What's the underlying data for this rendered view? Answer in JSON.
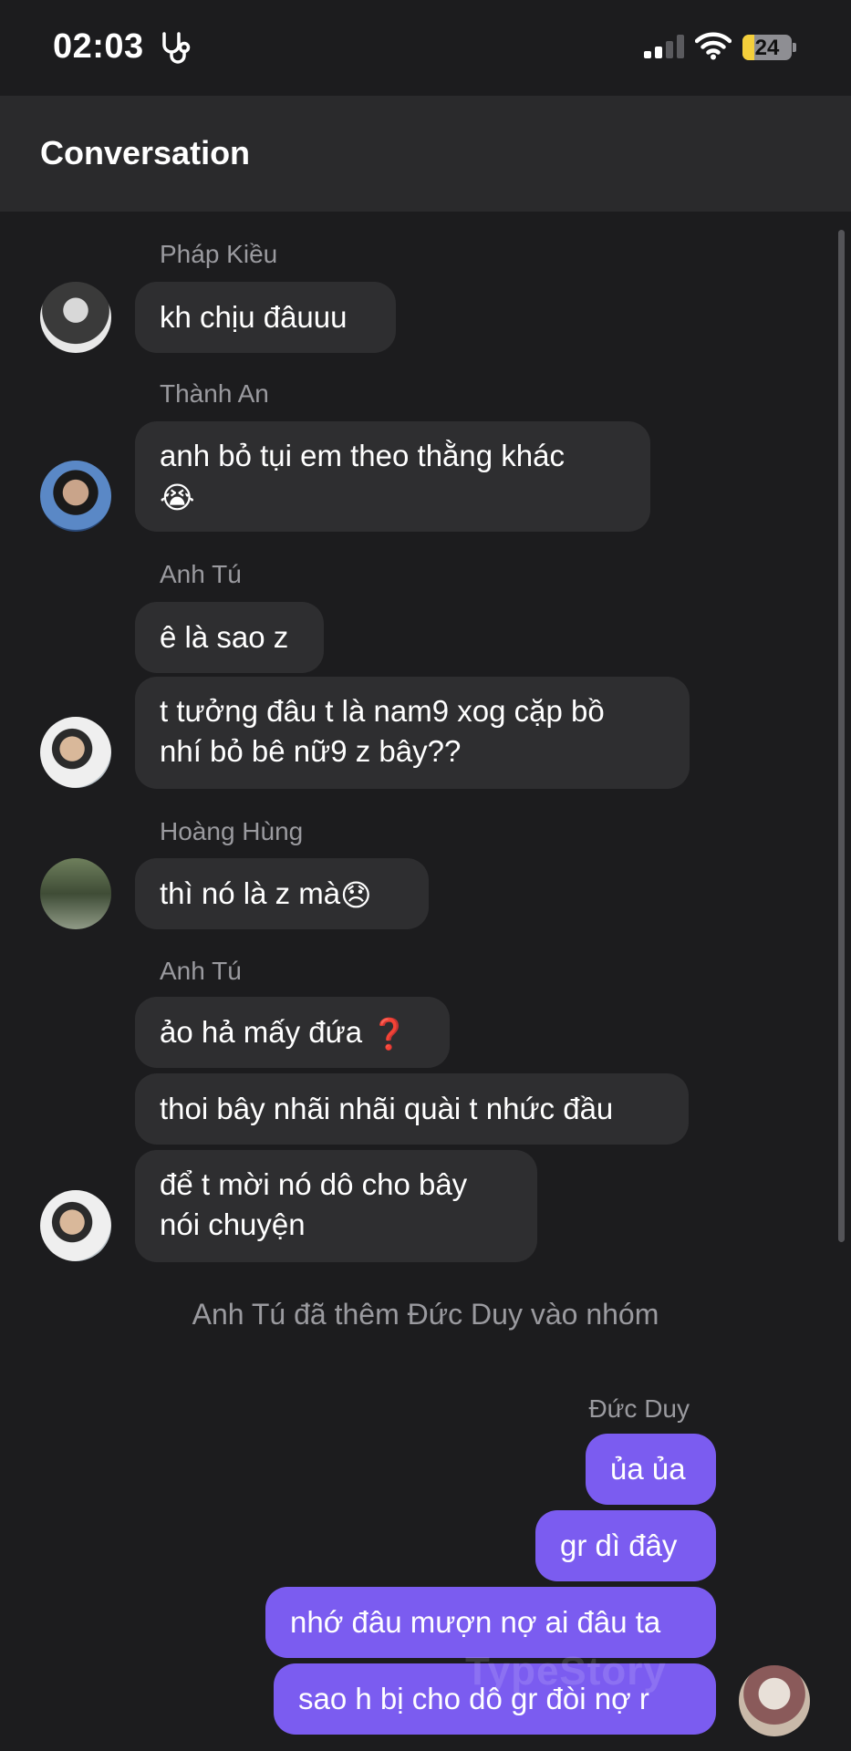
{
  "status_bar": {
    "time": "02:03",
    "battery": "24",
    "battery_level": 0.24,
    "signal_bars_active": 2,
    "icons": [
      "stethoscope-icon",
      "signal-icon",
      "wifi-icon",
      "battery-icon"
    ]
  },
  "header": {
    "title": "Conversation"
  },
  "messages": {
    "m1": {
      "sender": "Pháp Kiều",
      "bubbles": [
        "kh chịu đâuuu"
      ]
    },
    "m2": {
      "sender": "Thành An",
      "bubbles": [
        "anh bỏ tụi em theo thằng khác"
      ],
      "emoji": "😭"
    },
    "m3": {
      "sender": "Anh Tú",
      "bubbles": [
        "ê là sao z",
        "t tưởng đâu t là nam9 xog cặp bồ",
        "nhí bỏ bê nữ9 z bây??"
      ]
    },
    "m4": {
      "sender": "Hoàng Hùng",
      "bubbles": [
        "thì nó là z mà"
      ],
      "emoji": "😞"
    },
    "m5": {
      "sender": "Anh Tú",
      "bubbles": [
        "ảo hả mấy đứa",
        "thoi bây nhãi nhãi quài t nhức đầu",
        "để t mời nó dô cho bây",
        "nói chuyện"
      ],
      "emoji": "❓"
    },
    "system": "Anh Tú đã thêm Đức Duy vào nhóm",
    "me": {
      "sender": "Đức Duy",
      "bubbles": [
        "ủa ủa",
        "gr dì đây",
        "nhớ đâu mượn nợ ai đâu ta",
        "sao h bị cho dô gr đòi nợ r"
      ]
    }
  },
  "watermark": "TypeStory",
  "colors": {
    "background": "#1c1c1e",
    "header": "#2a2a2c",
    "incoming_bubble": "#2e2e30",
    "outgoing_bubble": "#7b5cf0",
    "muted_text": "#9a9a9f"
  }
}
